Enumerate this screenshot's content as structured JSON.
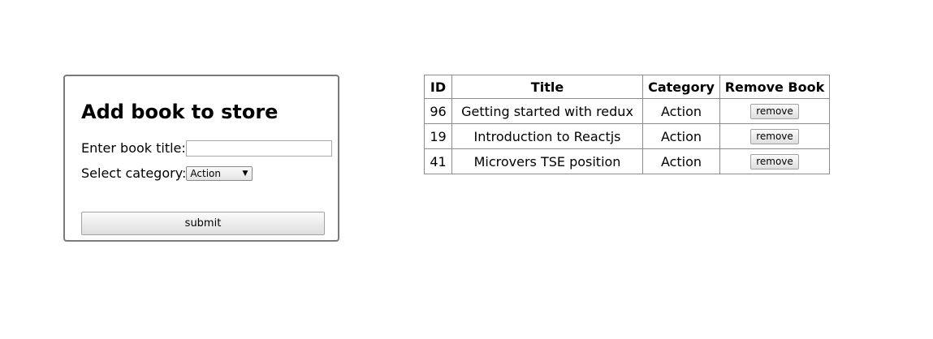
{
  "form": {
    "title": "Add book to store",
    "title_label": "Enter book title:",
    "title_value": "",
    "category_label": "Select category:",
    "category_selected": "Action",
    "submit_label": "submit"
  },
  "table": {
    "headers": [
      "ID",
      "Title",
      "Category",
      "Remove Book"
    ],
    "rows": [
      {
        "id": "96",
        "title": "Getting started with redux",
        "category": "Action",
        "remove_label": "remove"
      },
      {
        "id": "19",
        "title": "Introduction to Reactjs",
        "category": "Action",
        "remove_label": "remove"
      },
      {
        "id": "41",
        "title": "Microvers TSE position",
        "category": "Action",
        "remove_label": "remove"
      }
    ]
  },
  "icons": {
    "select_arrow": "dropdown-arrow-icon"
  }
}
